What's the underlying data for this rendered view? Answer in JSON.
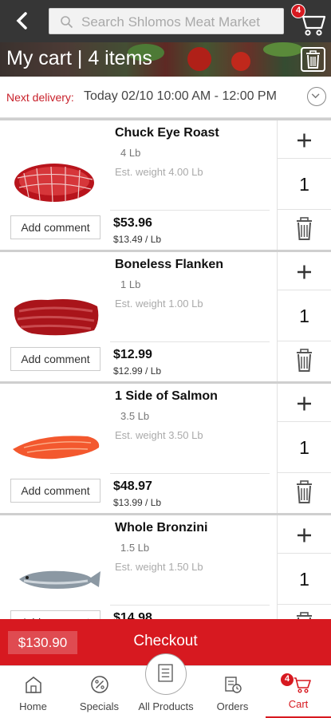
{
  "search": {
    "placeholder": "Search Shlomos Meat Market"
  },
  "top_cart_count": "4",
  "banner": {
    "title": "My cart | 4 items"
  },
  "delivery": {
    "label": "Next delivery:",
    "value": "Today 02/10 10:00 AM - 12:00 PM"
  },
  "items": [
    {
      "name": "Chuck Eye Roast",
      "qty_unit": "4 Lb",
      "est": "Est. weight 4.00 Lb",
      "price": "$53.96",
      "unit_price": "$13.49 / Lb",
      "count": "1",
      "comment": "Add comment",
      "image": "chuck-roast"
    },
    {
      "name": "Boneless Flanken",
      "qty_unit": "1 Lb",
      "est": "Est. weight 1.00 Lb",
      "price": "$12.99",
      "unit_price": "$12.99 / Lb",
      "count": "1",
      "comment": "Add comment",
      "image": "flanken"
    },
    {
      "name": "1 Side of Salmon",
      "qty_unit": "3.5 Lb",
      "est": "Est. weight 3.50 Lb",
      "price": "$48.97",
      "unit_price": "$13.99 / Lb",
      "count": "1",
      "comment": "Add comment",
      "image": "salmon"
    },
    {
      "name": "Whole Bronzini",
      "qty_unit": "1.5 Lb",
      "est": "Est. weight 1.50 Lb",
      "price": "$14.98",
      "unit_price": "",
      "count": "1",
      "comment": "Add comment",
      "image": "fish"
    }
  ],
  "checkout": {
    "total": "$130.90",
    "label": "Checkout"
  },
  "nav": {
    "home": "Home",
    "specials": "Specials",
    "all_products": "All Products",
    "orders": "Orders",
    "cart": "Cart",
    "cart_badge": "4"
  },
  "colors": {
    "accent": "#d71920",
    "topbar": "#363636"
  }
}
